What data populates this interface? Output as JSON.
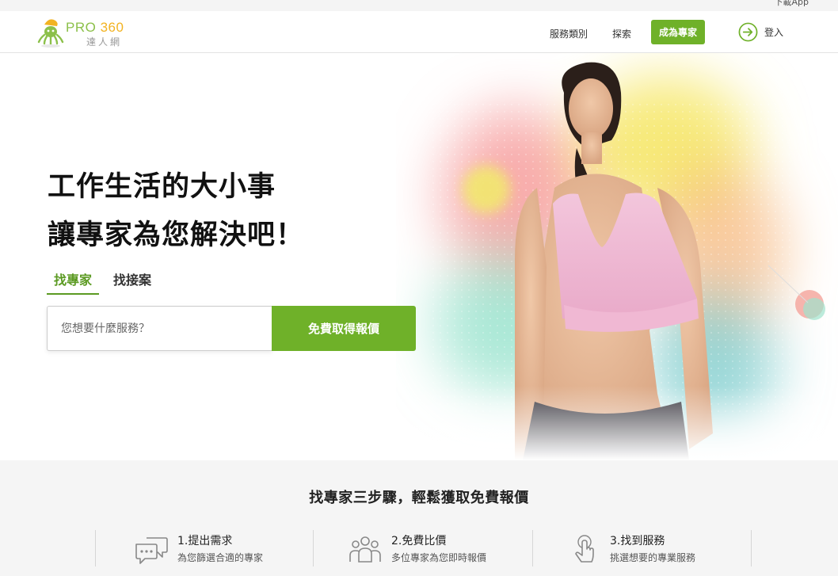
{
  "topbar": {
    "download_label": "下載App"
  },
  "logo": {
    "word": "PRO",
    "number": "360",
    "subtitle": "達人網"
  },
  "nav": {
    "categories": "服務類別",
    "explore": "探索",
    "become_pro": "成為專家",
    "login": "登入"
  },
  "hero": {
    "headline_line1": "工作生活的大小事",
    "headline_line2": "讓專家為您解決吧！",
    "tabs": [
      {
        "label": "找專家",
        "active": true
      },
      {
        "label": "找接案",
        "active": false
      }
    ],
    "search": {
      "placeholder": "您想要什麼服務？",
      "value": ""
    },
    "cta": "免費取得報價"
  },
  "steps_section": {
    "title": "找專家三步驟，輕鬆獲取免費報價",
    "steps": [
      {
        "icon": "chat-bubbles-icon",
        "title": "1.提出需求",
        "desc": "為您篩選合適的專家"
      },
      {
        "icon": "people-group-icon",
        "title": "2.免費比價",
        "desc": "多位專家為您即時報價"
      },
      {
        "icon": "hand-tap-icon",
        "title": "3.找到服務",
        "desc": "挑選想要的專業服務"
      }
    ]
  },
  "colors": {
    "brand_green": "#6fb129",
    "tab_green": "#5b9a22",
    "logo_orange": "#f2b322"
  }
}
